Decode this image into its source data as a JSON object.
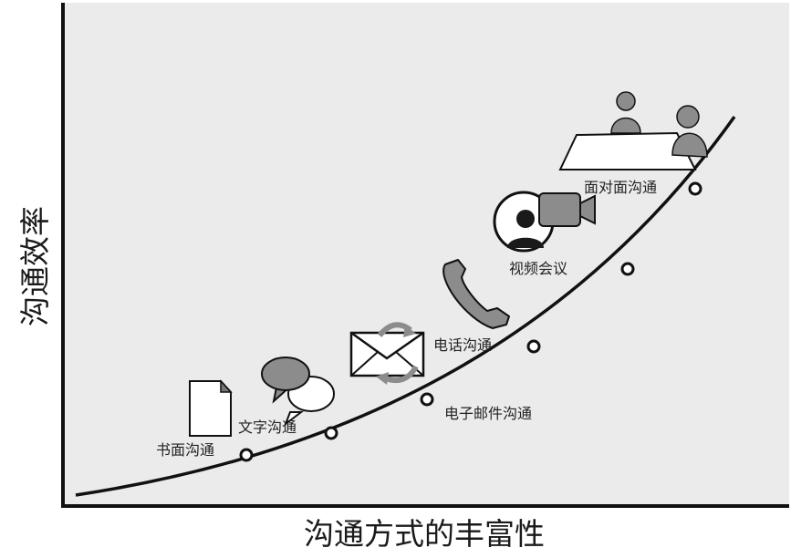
{
  "axes": {
    "y_title": "沟通效率",
    "x_title": "沟通方式的丰富性"
  },
  "methods": [
    {
      "label": "书面沟通",
      "icon": "document-icon"
    },
    {
      "label": "文字沟通",
      "icon": "chat-bubbles-icon"
    },
    {
      "label": "电子邮件沟通",
      "icon": "email-envelope-icon"
    },
    {
      "label": "电话沟通",
      "icon": "telephone-handset-icon"
    },
    {
      "label": "视频会议",
      "icon": "video-camera-icon"
    },
    {
      "label": "面对面沟通",
      "icon": "meeting-table-icon"
    }
  ],
  "colors": {
    "background": "#ebebeb",
    "axis": "#111111",
    "curve": "#111111",
    "icon_gray": "#8c8c8c",
    "icon_dark": "#1a1a1a"
  }
}
